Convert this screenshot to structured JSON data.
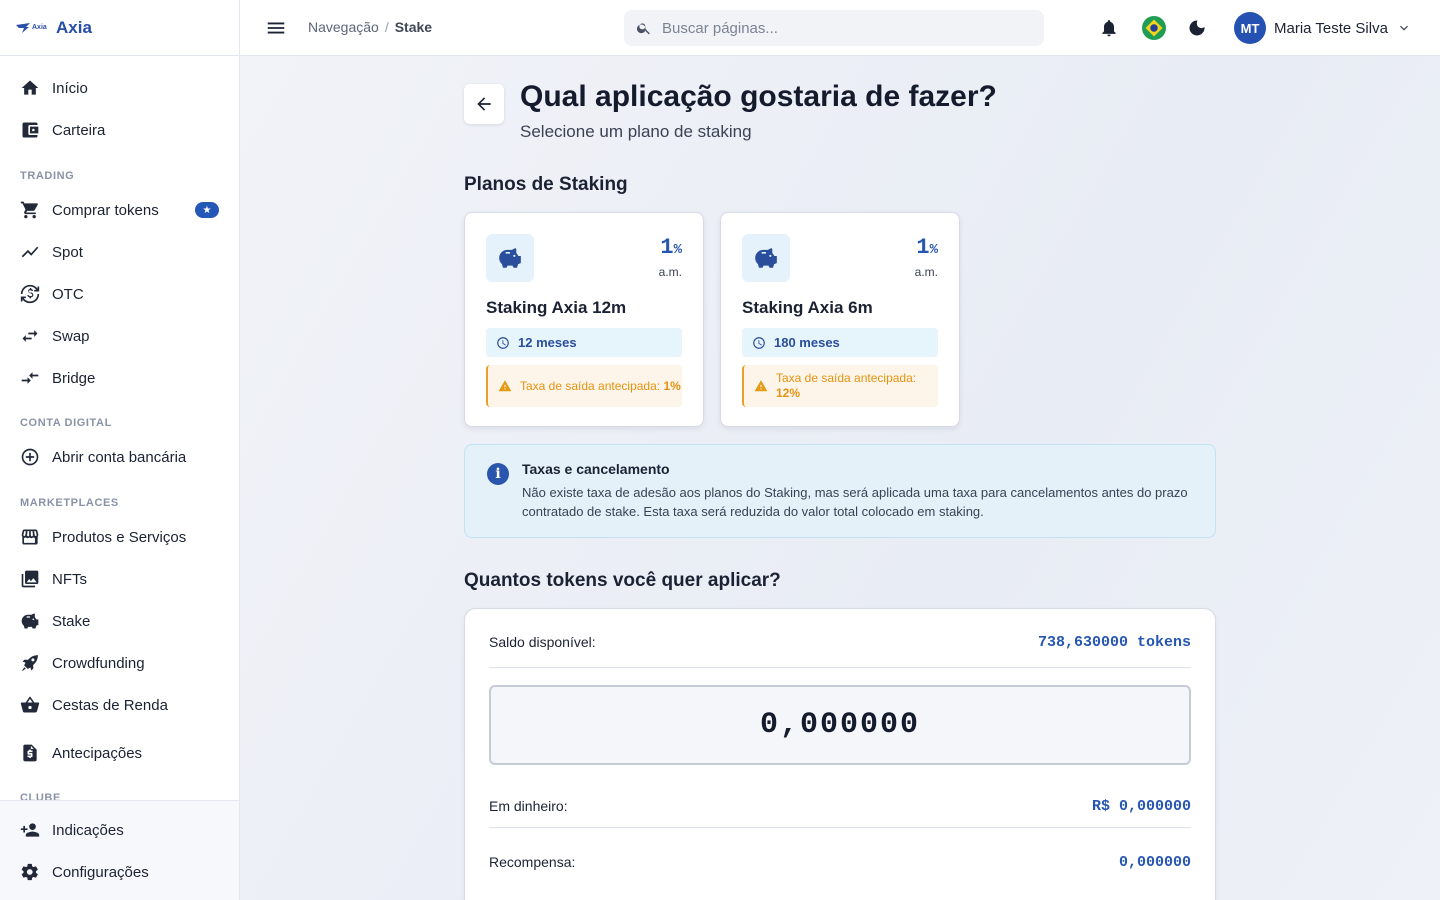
{
  "brand": {
    "logo_text": "Axia",
    "name": "Axia"
  },
  "sidebar": {
    "items": [
      {
        "label": "Início",
        "icon": "home-icon"
      },
      {
        "label": "Carteira",
        "icon": "wallet-icon"
      },
      {
        "label": "Comprar tokens",
        "icon": "cart-icon",
        "badge": "star"
      },
      {
        "label": "Spot",
        "icon": "trend-icon"
      },
      {
        "label": "OTC",
        "icon": "currency-exchange-icon"
      },
      {
        "label": "Swap",
        "icon": "swap-icon"
      },
      {
        "label": "Bridge",
        "icon": "bridge-icon"
      },
      {
        "label": "Abrir conta bancária",
        "icon": "add-circle-icon"
      },
      {
        "label": "Produtos e Serviços",
        "icon": "store-icon"
      },
      {
        "label": "NFTs",
        "icon": "images-icon"
      },
      {
        "label": "Stake",
        "icon": "piggy-bank-icon"
      },
      {
        "label": "Crowdfunding",
        "icon": "rocket-icon"
      },
      {
        "label": "Cestas de Renda",
        "icon": "basket-icon"
      },
      {
        "label": "Antecipações",
        "icon": "invoice-icon"
      }
    ],
    "sections": {
      "trading": "TRADING",
      "conta_digital": "CONTA DIGITAL",
      "marketplaces": "MARKETPLACES",
      "clube": "CLUBE"
    },
    "bottom": [
      {
        "label": "Indicações",
        "icon": "add-person-icon"
      },
      {
        "label": "Configurações",
        "icon": "gear-icon"
      }
    ]
  },
  "topbar": {
    "breadcrumb": {
      "parent": "Navegação",
      "separator": "/",
      "current": "Stake"
    },
    "search": {
      "placeholder": "Buscar páginas..."
    },
    "user": {
      "initials": "MT",
      "name": "Maria Teste Silva"
    }
  },
  "page": {
    "title": "Qual aplicação gostaria de fazer?",
    "subtitle": "Selecione um plano de staking",
    "plans_title": "Planos de Staking",
    "plans": [
      {
        "rate": "1",
        "rate_unit": "%",
        "period": "a.m.",
        "name": "Staking Axia 12m",
        "duration": "12 meses",
        "fee_text": "Taxa de saída antecipada:",
        "fee_value": "1%"
      },
      {
        "rate": "1",
        "rate_unit": "%",
        "period": "a.m.",
        "name": "Staking Axia 6m",
        "duration": "180 meses",
        "fee_text": "Taxa de saída antecipada:",
        "fee_value": "12%"
      }
    ],
    "info": {
      "title": "Taxas e cancelamento",
      "body": "Não existe taxa de adesão aos planos do Staking, mas será aplicada uma taxa para cancelamentos antes do prazo contratado de stake. Esta taxa será reduzida do valor total colocado em staking."
    },
    "amount_title": "Quantos tokens você quer aplicar?",
    "amount": {
      "balance_label": "Saldo disponível:",
      "balance_value": "738,630000 tokens",
      "input_value": "0,000000",
      "cash_label": "Em dinheiro:",
      "cash_value": "R$ 0,000000",
      "reward_label": "Recompensa:",
      "reward_value": "0,000000"
    }
  },
  "colors": {
    "accent": "#2556b0",
    "warning": "#e39310",
    "info_bg": "#e4f1f9"
  }
}
